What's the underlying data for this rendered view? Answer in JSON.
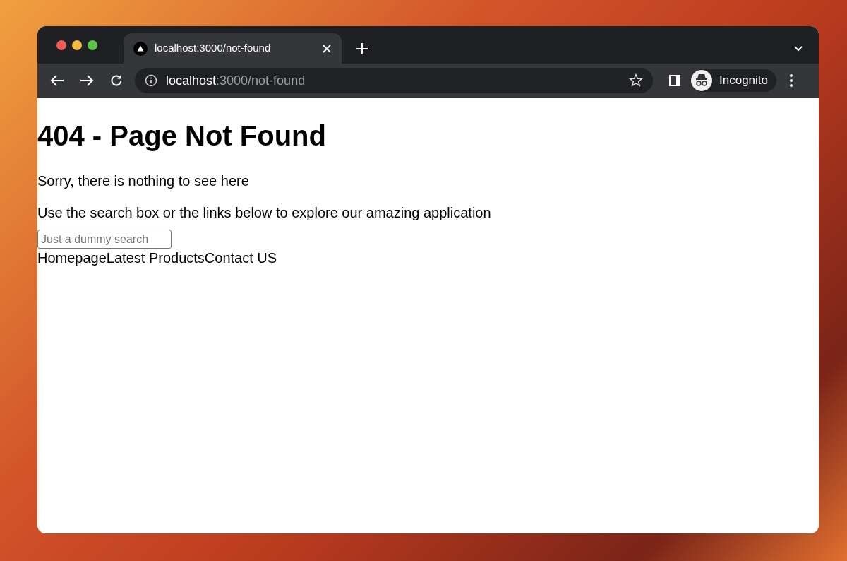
{
  "browser": {
    "tab": {
      "title": "localhost:3000/not-found",
      "selected": true
    },
    "address_bar": {
      "host": "localhost",
      "path": ":3000/not-found"
    },
    "profile": {
      "label": "Incognito"
    }
  },
  "page": {
    "heading": "404 - Page Not Found",
    "paragraphs": [
      "Sorry, there is nothing to see here",
      "Use the search box or the links below to explore our amazing application"
    ],
    "search": {
      "placeholder": "Just a dummy search"
    },
    "links": [
      "Homepage",
      "Latest Products",
      "Contact US"
    ]
  }
}
